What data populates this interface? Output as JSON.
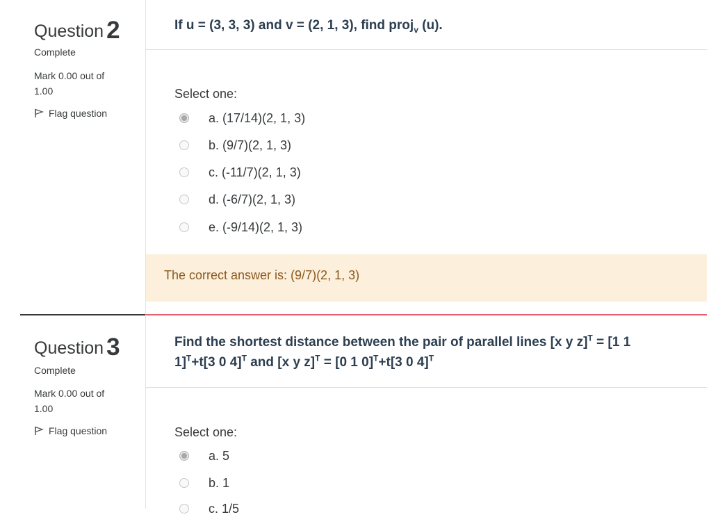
{
  "questions": [
    {
      "label": "Question",
      "number": "2",
      "state": "Complete",
      "grade": "Mark 0.00 out of 1.00",
      "flag": "Flag question",
      "text_parts": [
        "If u = (3, 3, 3) and v = (2, 1, 3), find proj",
        "v",
        " (u)."
      ],
      "prompt": "Select one:",
      "options": [
        {
          "label": "a. (17/14)(2, 1, 3)",
          "checked": true
        },
        {
          "label": "b. (9/7)(2, 1, 3)",
          "checked": false
        },
        {
          "label": "c. (-11/7)(2, 1, 3)",
          "checked": false
        },
        {
          "label": "d. (-6/7)(2, 1, 3)",
          "checked": false
        },
        {
          "label": "e. (-9/14)(2, 1, 3)",
          "checked": false
        }
      ],
      "feedback": "The correct answer is: (9/7)(2, 1, 3)"
    },
    {
      "label": "Question",
      "number": "3",
      "state": "Complete",
      "grade": "Mark 0.00 out of 1.00",
      "flag": "Flag question",
      "text_parts": [
        "Find the shortest distance between the pair of parallel lines [x  y  z]",
        "T",
        " = [1  1  1]",
        "T",
        "+t[3  0  4]",
        "T",
        " and  [x  y  z]",
        "T",
        " = [0  1  0]",
        "T",
        "+t[3  0  4]",
        "T"
      ],
      "prompt": "Select one:",
      "options": [
        {
          "label": "a. 5",
          "checked": true
        },
        {
          "label": "b. 1",
          "checked": false
        },
        {
          "label": "c. 1/5",
          "checked": false
        }
      ]
    }
  ],
  "colors": {
    "accent_divider": "#e8606f",
    "feedback_bg": "#fcefdc",
    "feedback_text": "#8a5a1e",
    "question_text": "#2c3e50"
  },
  "icons": {
    "flag": "flag-icon"
  }
}
